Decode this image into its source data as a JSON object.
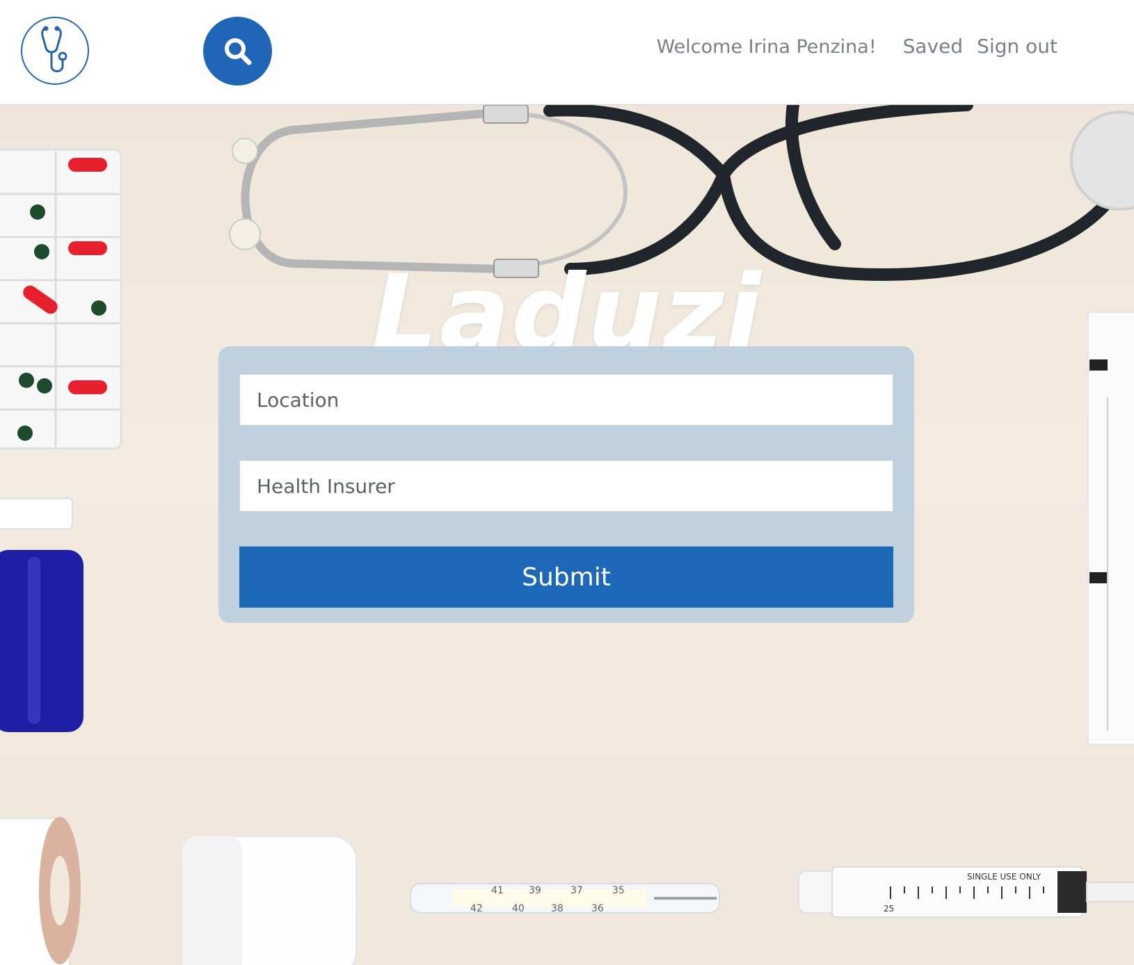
{
  "header": {
    "logo_icon": "stethoscope-icon",
    "search_icon": "search-icon",
    "welcome_text": "Welcome Irina Penzina!",
    "nav_links": [
      "Saved",
      "Sign out"
    ]
  },
  "hero": {
    "brand": "Laduzi"
  },
  "form": {
    "location_placeholder": "Location",
    "insurer_placeholder": "Health Insurer",
    "submit_label": "Submit"
  },
  "decor": {
    "thermometer_top": [
      "35",
      "37",
      "39",
      "41"
    ],
    "thermometer_bottom": [
      "36",
      "38",
      "40",
      "42"
    ],
    "syringe_label": "SINGLE USE ONLY",
    "syringe_scale": "25"
  },
  "colors": {
    "brand_blue": "#1f67b6",
    "panel": "#bbcdde",
    "background": "#f0e8dc"
  }
}
